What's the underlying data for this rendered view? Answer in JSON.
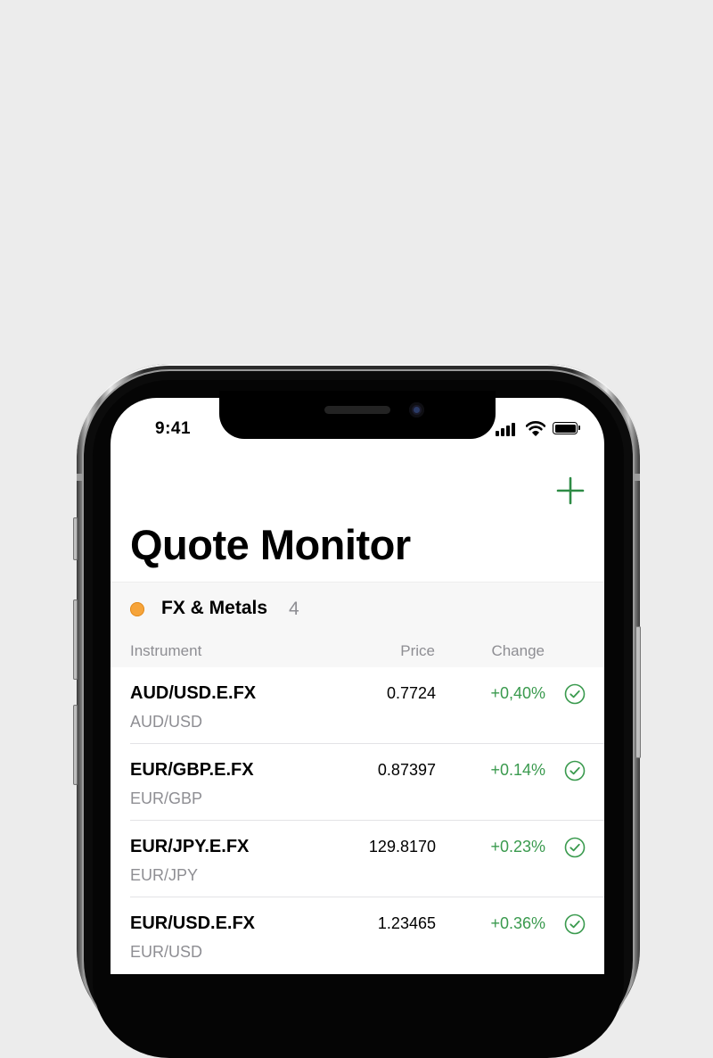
{
  "status": {
    "time": "9:41"
  },
  "toolbar": {
    "add_icon": "plus-icon"
  },
  "page": {
    "title": "Quote Monitor"
  },
  "section": {
    "title": "FX & Metals",
    "count": "4",
    "dot_color": "#f6a43a"
  },
  "columns": {
    "instrument": "Instrument",
    "price": "Price",
    "change": "Change"
  },
  "colors": {
    "accent": "#2e8b45",
    "positive": "#3a9a4e",
    "muted": "#8e8e93"
  },
  "quotes": [
    {
      "symbol": "AUD/USD.E.FX",
      "description": "AUD/USD",
      "price": "0.7724",
      "change": "+0,40%",
      "status_icon": "check-circle-icon"
    },
    {
      "symbol": "EUR/GBP.E.FX",
      "description": "EUR/GBP",
      "price": "0.87397",
      "change": "+0.14%",
      "status_icon": "check-circle-icon"
    },
    {
      "symbol": "EUR/JPY.E.FX",
      "description": "EUR/JPY",
      "price": "129.8170",
      "change": "+0.23%",
      "status_icon": "check-circle-icon"
    },
    {
      "symbol": "EUR/USD.E.FX",
      "description": "EUR/USD",
      "price": "1.23465",
      "change": "+0.36%",
      "status_icon": "check-circle-icon"
    }
  ]
}
